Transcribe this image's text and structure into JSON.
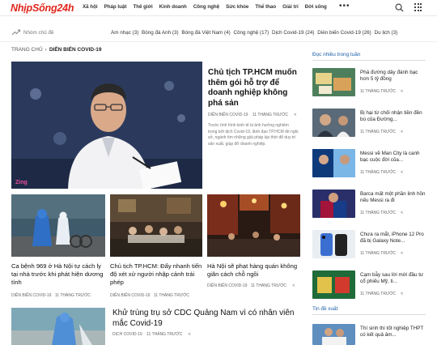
{
  "logo": "NhịpSống24h",
  "nav": [
    "Xã hội",
    "Pháp luật",
    "Thế giới",
    "Kinh doanh",
    "Công nghệ",
    "Sức khỏe",
    "Thể thao",
    "Giải trí",
    "Đời sống"
  ],
  "trending": {
    "label": "Nhóm chủ đề",
    "topics": [
      "Âm nhạc (3)",
      "Bóng đá Anh (3)",
      "Bóng đá Việt Nam (4)",
      "Công nghệ (17)",
      "Dịch Covid-19 (24)",
      "Diễn biến Covid-19 (26)",
      "Du lịch (3)"
    ]
  },
  "breadcrumb": {
    "home": "TRANG CHỦ",
    "current": "DIỄN BIẾN COVID-19"
  },
  "hero": {
    "title": "Chủ tịch TP.HCM muốn thêm gói hỗ trợ để doanh nghiệp không phá sản",
    "category": "DIỄN BIẾN COVID-19",
    "date": "11 THÁNG TRƯỚC",
    "summary": "Trước tình hình kinh tế bị ảnh hưởng nghiêm trọng bởi dịch Covid-19, lãnh đạo TP.HCM đề nghị sở, ngành tìm những giải pháp kịp thời để duy trì sản xuất, giúp đỡ doanh nghiệp.",
    "watermark": "Zing"
  },
  "cards": [
    {
      "title": "Ca bệnh 969 ở Hà Nội tự cách ly tại nhà trước khi phát hiện dương tính",
      "category": "DIỄN BIẾN COVID-19",
      "date": "11 THÁNG TRƯỚC"
    },
    {
      "title": "Chủ tịch TP.HCM: Đẩy nhanh tiến độ xét xử người nhập cảnh trái phép",
      "category": "DIỄN BIẾN COVID-19",
      "date": "11 THÁNG TRƯỚC"
    },
    {
      "title": "Hà Nội sẽ phạt hàng quán không giãn cách chỗ ngồi",
      "category": "DIỄN BIẾN COVID-19",
      "date": "11 THÁNG TRƯỚC"
    }
  ],
  "bottom": {
    "title": "Khử trùng trụ sở CDC Quảng Nam vì có nhân viên mắc Covid-19",
    "category": "DỊCH COVID-19",
    "date": "11 THÁNG TRƯỚC"
  },
  "sidebar": {
    "heading": "Đọc nhiều trong tuần",
    "items": [
      {
        "title": "Phá đường dây đánh bạc hơn 5 tỷ đồng",
        "date": "11 THÁNG TRƯỚC"
      },
      {
        "title": "Bị hại từ chối nhận tiền đền bù của Đường...",
        "date": "11 THÁNG TRƯỚC"
      },
      {
        "title": "Messi về Man City là canh bạc cuộc đời của...",
        "date": "11 THÁNG TRƯỚC"
      },
      {
        "title": "Barca mất một phần linh hồn nếu Messi ra đi",
        "date": "11 THÁNG TRƯỚC"
      },
      {
        "title": "Chưa ra mắt, iPhone 12 Pro đã bị Galaxy Note...",
        "date": "11 THÁNG TRƯỚC"
      },
      {
        "title": "Cạm bẫy sau lời mời đầu tư cổ phiếu Mỹ, ti...",
        "date": "11 THÁNG TRƯỚC"
      }
    ],
    "heading2": "Tin đề xuất",
    "items2": [
      {
        "title": "Thí sinh thi tốt nghiệp THPT có kết quả âm..."
      }
    ]
  }
}
